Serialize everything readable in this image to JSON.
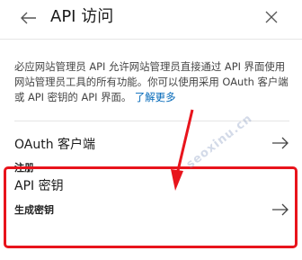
{
  "header": {
    "back_icon": "arrow-left-icon",
    "title": "API 访问",
    "close_icon": "close-icon"
  },
  "description": {
    "text": "必应网站管理员 API 允许网站管理员直接通过 API 界面使用网站管理员工具的所有功能。你可以使用采用 OAuth 客户端或 API 密钥的 API 界面。",
    "link": "了解更多"
  },
  "options": [
    {
      "title": "OAuth 客户端",
      "subtitle": "注册",
      "icon": "arrow-right-icon"
    },
    {
      "title": "API 密钥",
      "subtitle": "生成密钥",
      "icon": "arrow-right-icon"
    }
  ],
  "annotation": {
    "highlight_color": "#e8141c",
    "arrow_color": "#e8141c"
  },
  "watermark": "seoxinu.cn"
}
